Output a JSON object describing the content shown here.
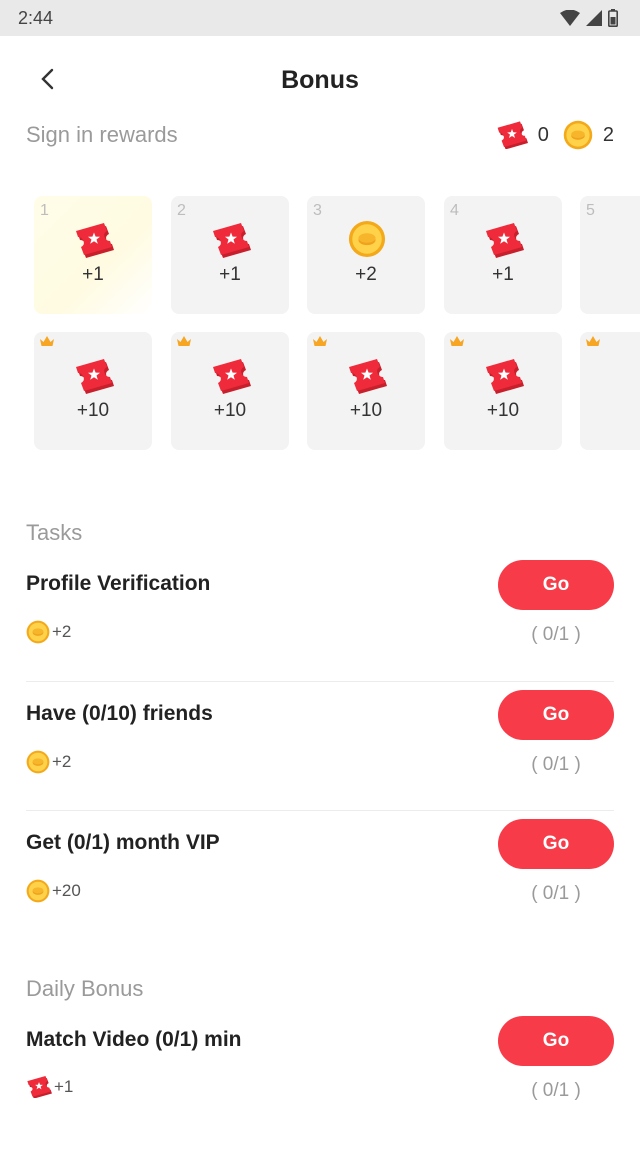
{
  "status": {
    "time": "2:44"
  },
  "header": {
    "title": "Bonus"
  },
  "sign_in": {
    "title": "Sign in rewards",
    "ticket_balance": "0",
    "coin_balance": "2",
    "days": [
      {
        "day": "1",
        "reward": "+1",
        "icon": "ticket-icon"
      },
      {
        "day": "2",
        "reward": "+1",
        "icon": "ticket-icon"
      },
      {
        "day": "3",
        "reward": "+2",
        "icon": "coin-icon"
      },
      {
        "day": "4",
        "reward": "+1",
        "icon": "ticket-icon"
      },
      {
        "day": "5",
        "reward": "",
        "icon": ""
      }
    ],
    "vip_days": [
      {
        "reward": "+10",
        "icon": "ticket-icon"
      },
      {
        "reward": "+10",
        "icon": "ticket-icon"
      },
      {
        "reward": "+10",
        "icon": "ticket-icon"
      },
      {
        "reward": "+10",
        "icon": "ticket-icon"
      },
      {
        "reward": "",
        "icon": ""
      }
    ]
  },
  "tasks": {
    "title": "Tasks",
    "items": [
      {
        "title": "Profile Verification",
        "reward": "+2",
        "button": "Go",
        "progress": "( 0/1 )"
      },
      {
        "title": "Have (0/10) friends",
        "reward": "+2",
        "button": "Go",
        "progress": "( 0/1 )"
      },
      {
        "title": "Get (0/1) month VIP",
        "reward": "+20",
        "button": "Go",
        "progress": "( 0/1 )"
      }
    ]
  },
  "daily": {
    "title": "Daily Bonus",
    "items": [
      {
        "title": "Match Video (0/1) min",
        "reward": "+1",
        "button": "Go",
        "progress": "( 0/1 )"
      }
    ]
  },
  "colors": {
    "accent": "#f73b48",
    "coin": "#f5b51f",
    "ticket": "#e8283a"
  }
}
